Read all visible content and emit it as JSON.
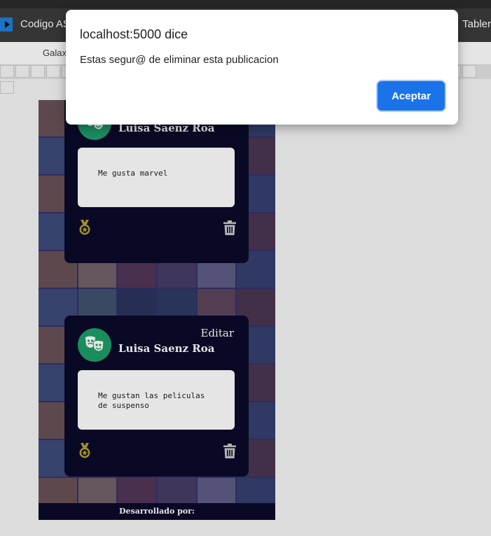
{
  "browser": {
    "tab_title": "Codigo AS",
    "tab_title_right": "Tabler",
    "bookmark": "Galax"
  },
  "dialog": {
    "title": "localhost:5000 dice",
    "message": "Estas segur@ de eliminar esta publicacion",
    "button_label": "Aceptar",
    "button_color": "#1a73e8"
  },
  "posts": [
    {
      "author": "Luisa Saenz Roa",
      "body": "Me gusta marvel",
      "edit_label": ""
    },
    {
      "author": "Luisa Saenz Roa",
      "body": "Me gustan las peliculas\nde suspenso",
      "edit_label": "Editar"
    }
  ],
  "footer": {
    "text": "Desarrollado por:"
  },
  "colors": {
    "card_bg": "#0b0b2a",
    "avatar_bg": "#1e9e6a",
    "medal": "#b5a12b"
  },
  "icons": {
    "avatar": "theater-masks-icon",
    "medal": "medal-icon",
    "delete": "trash-icon"
  }
}
